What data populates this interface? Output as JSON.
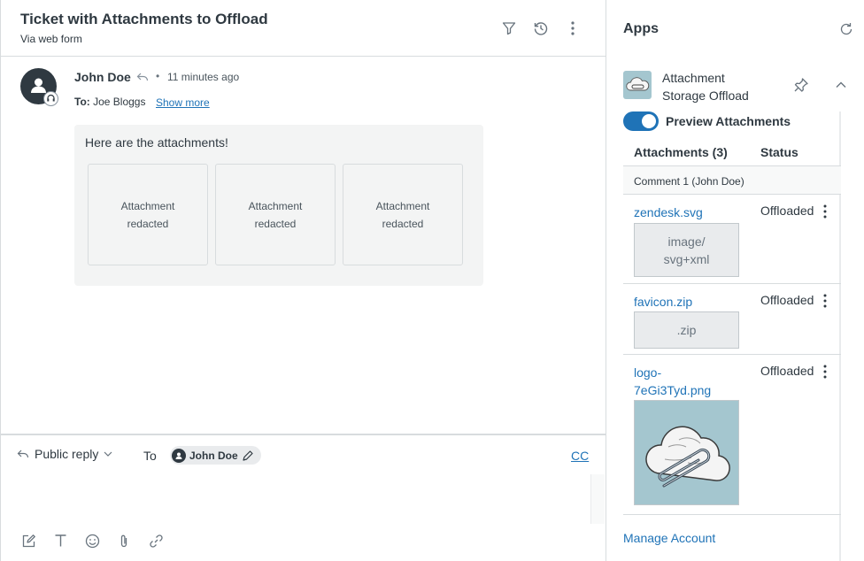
{
  "ticket": {
    "title": "Ticket with Attachments to Offload",
    "subtitle": "Via web form"
  },
  "header_icons": [
    "filter-icon",
    "history-icon",
    "more-options-icon"
  ],
  "message": {
    "author": "John Doe",
    "separator": "•",
    "timestamp": "11 minutes ago",
    "to_label": "To:",
    "to_name": "Joe Bloggs",
    "show_more": "Show more",
    "body": "Here are the attachments!",
    "attachments": [
      {
        "label": "Attachment redacted"
      },
      {
        "label": "Attachment redacted"
      },
      {
        "label": "Attachment redacted"
      }
    ]
  },
  "composer": {
    "reply_type": "Public reply",
    "to_label": "To",
    "recipient": "John Doe",
    "cc": "CC",
    "tools": [
      "compose-icon",
      "text-format-icon",
      "emoji-icon",
      "attachment-icon",
      "link-icon"
    ]
  },
  "apps": {
    "title": "Apps",
    "app_name": "Attachment Storage Offload",
    "toggle_label": "Preview Attachments",
    "toggle_on": true,
    "col_attachments": "Attachments (3)",
    "col_status": "Status",
    "group": "Comment 1 (John Doe)",
    "rows": [
      {
        "file": "zendesk.svg",
        "status": "Offloaded",
        "preview": "image/ svg+xml"
      },
      {
        "file": "favicon.zip",
        "status": "Offloaded",
        "preview": ".zip"
      },
      {
        "file": "logo-7eGi3Tyd.png",
        "status": "Offloaded",
        "preview": ""
      }
    ],
    "manage": "Manage Account"
  },
  "colors": {
    "accent": "#1f73b7",
    "text": "#2f3941",
    "border": "#d8dcde",
    "bubble": "#f3f4f4"
  }
}
